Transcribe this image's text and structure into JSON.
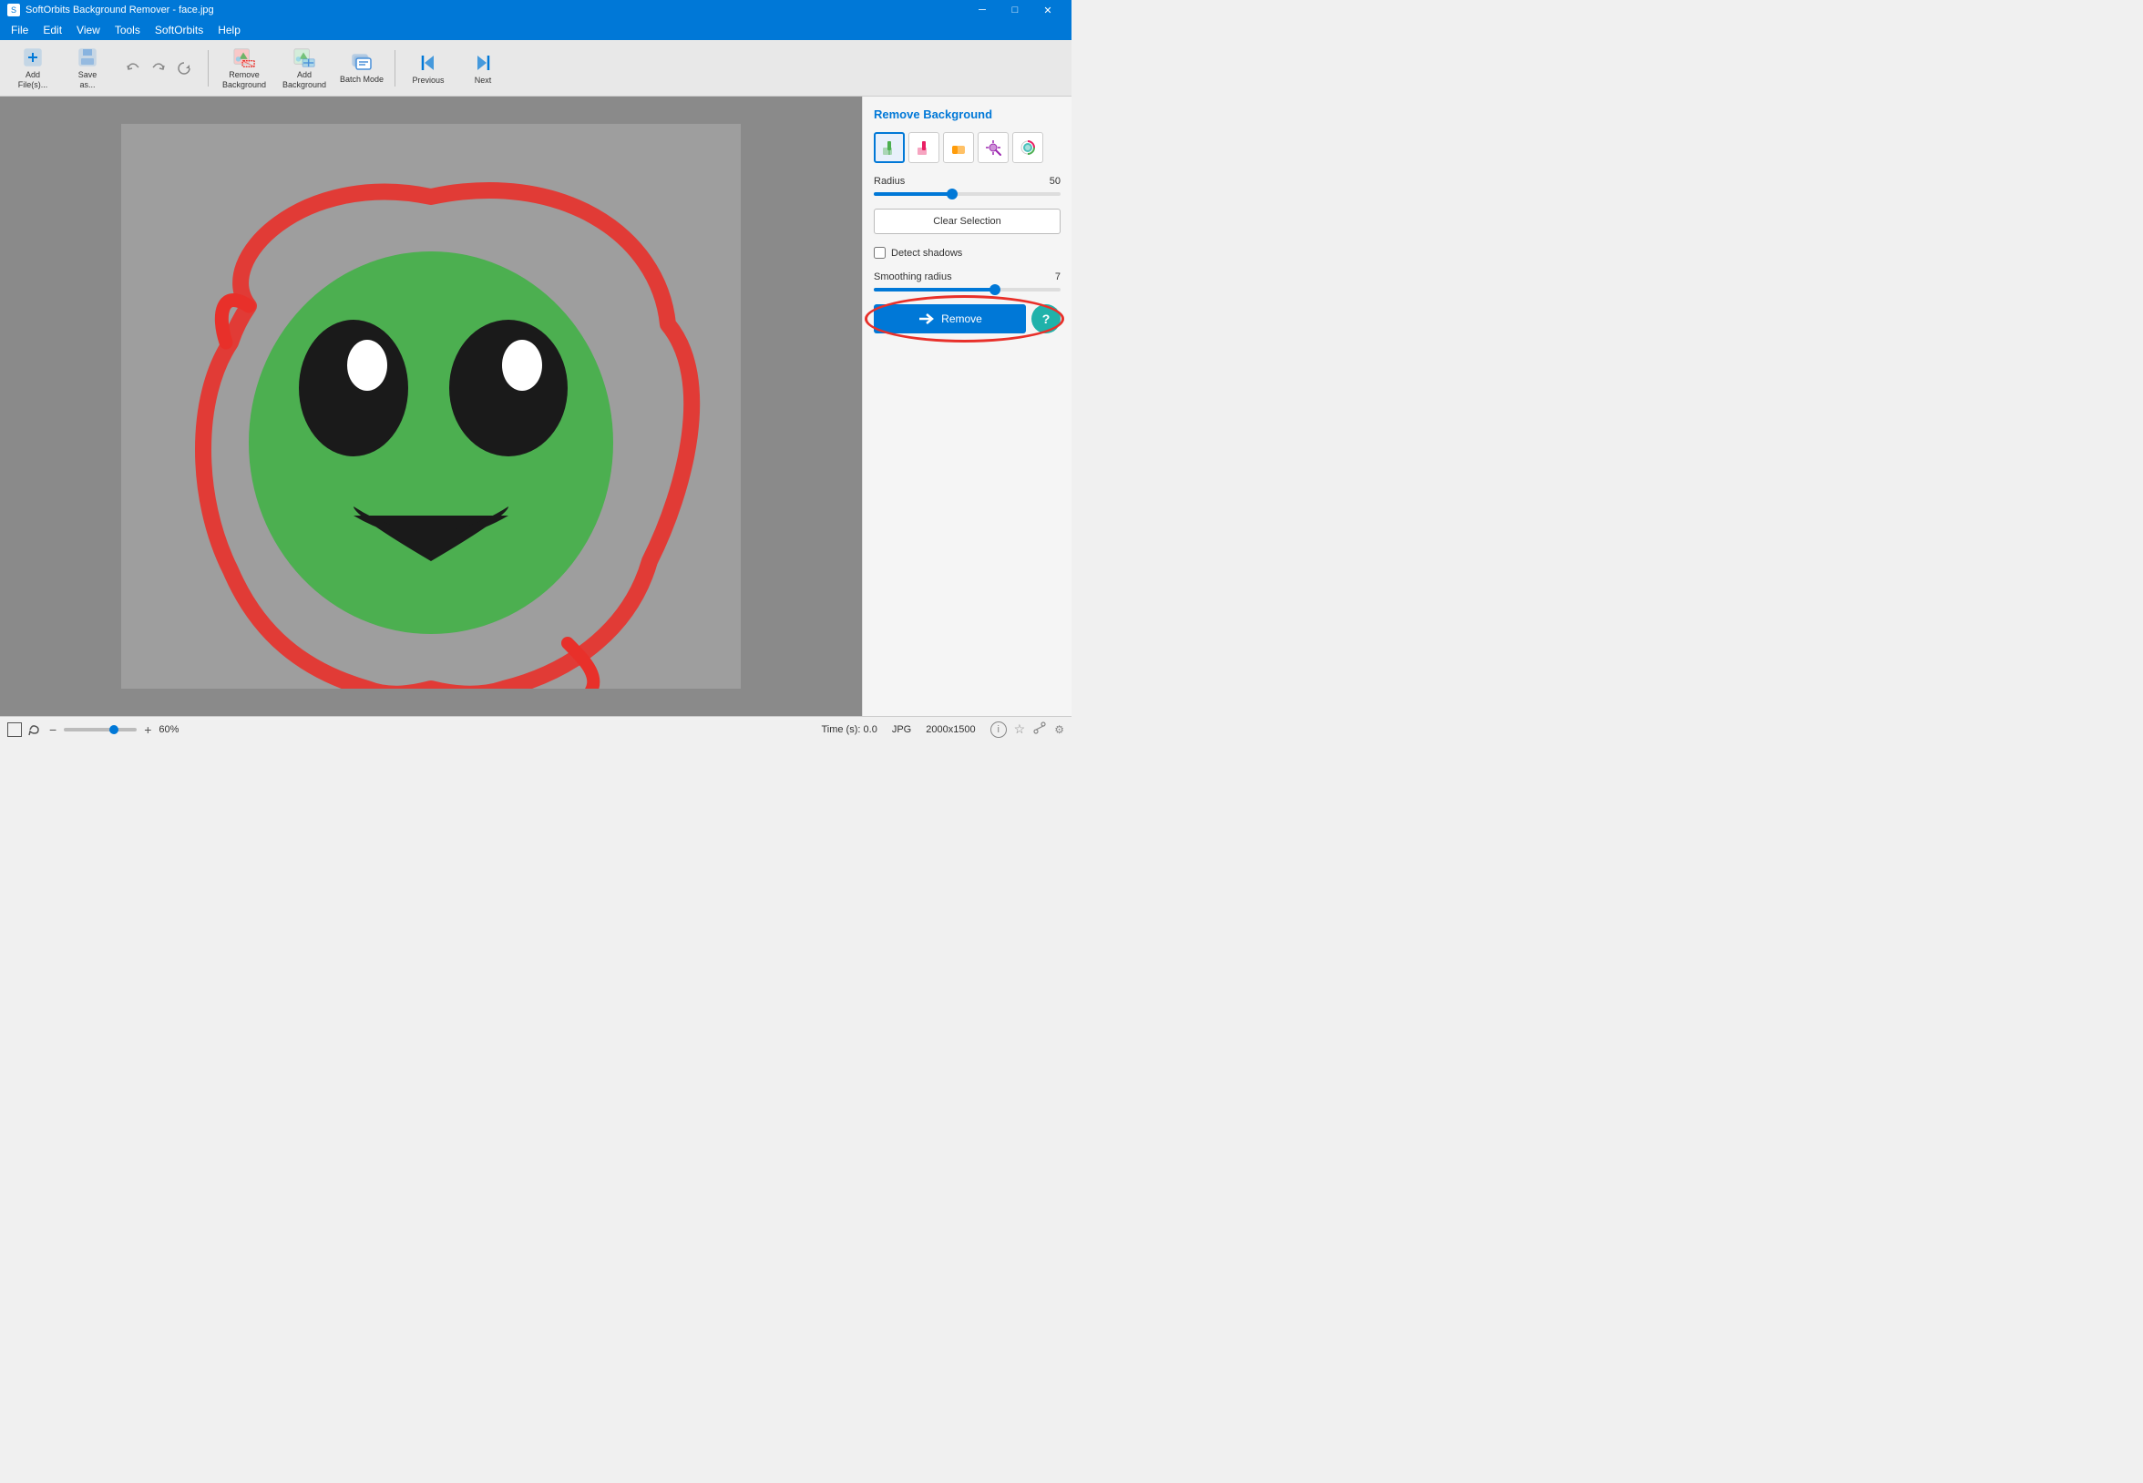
{
  "window": {
    "title": "SoftOrbits Background Remover - face.jpg"
  },
  "titlebar": {
    "title": "SoftOrbits Background Remover - face.jpg",
    "minimize": "─",
    "maximize": "□",
    "close": "✕"
  },
  "menu": {
    "items": [
      "File",
      "Edit",
      "View",
      "Tools",
      "SoftOrbits",
      "Help"
    ]
  },
  "toolbar": {
    "add_files_label": "Add\nFile(s)...",
    "save_as_label": "Save\nas...",
    "remove_bg_label": "Remove\nBackground",
    "add_bg_label": "Add\nBackground",
    "batch_mode_label": "Batch\nMode",
    "previous_label": "Previous",
    "next_label": "Next"
  },
  "right_panel": {
    "title": "Remove Background",
    "radius_label": "Radius",
    "radius_value": "50",
    "clear_selection_label": "Clear Selection",
    "detect_shadows_label": "Detect shadows",
    "smoothing_radius_label": "Smoothing radius",
    "smoothing_value": "7",
    "remove_label": "Remove",
    "tools": [
      {
        "name": "keep-brush",
        "symbol": "✏️"
      },
      {
        "name": "remove-brush",
        "symbol": "🖊️"
      },
      {
        "name": "eraser",
        "symbol": "🧹"
      },
      {
        "name": "magic-wand",
        "symbol": "🪄"
      },
      {
        "name": "color-select",
        "symbol": "🎨"
      }
    ]
  },
  "status": {
    "time_label": "Time (s):",
    "time_value": "0.0",
    "format": "JPG",
    "dimensions": "2000x1500",
    "zoom_value": "60%"
  }
}
